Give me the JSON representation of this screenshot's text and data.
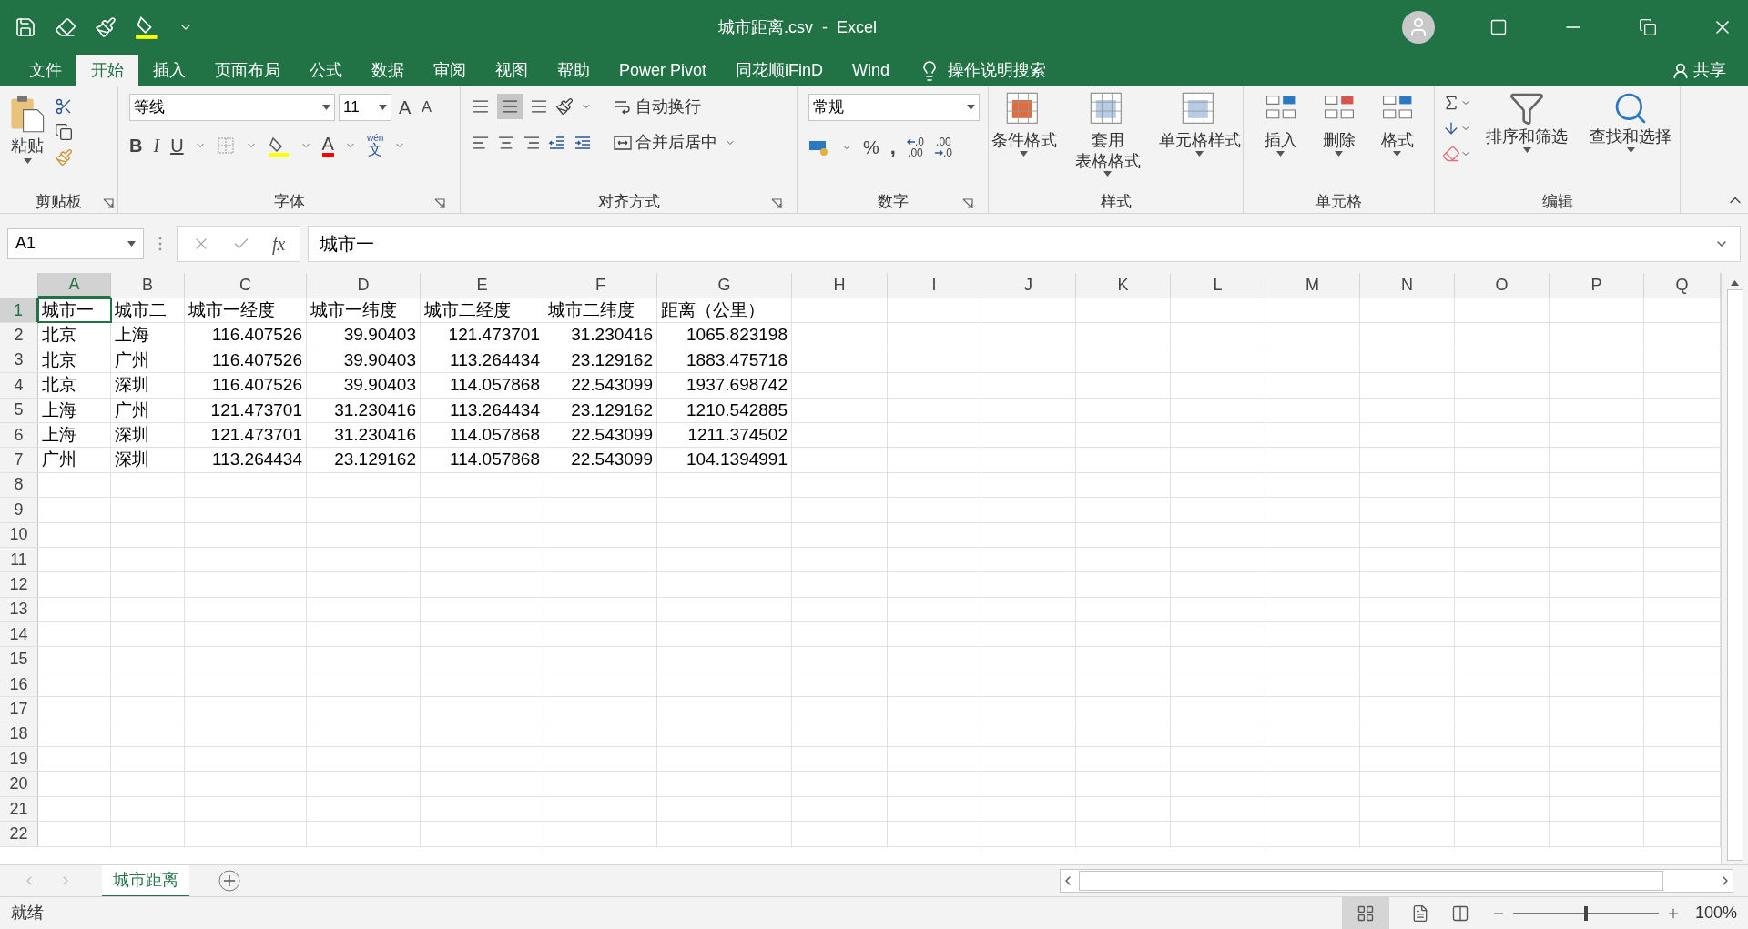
{
  "window": {
    "title": "城市距离.csv  -  Excel"
  },
  "ribbon_tabs": [
    {
      "label": "文件",
      "selected": false
    },
    {
      "label": "开始",
      "selected": true
    },
    {
      "label": "插入",
      "selected": false
    },
    {
      "label": "页面布局",
      "selected": false
    },
    {
      "label": "公式",
      "selected": false
    },
    {
      "label": "数据",
      "selected": false
    },
    {
      "label": "审阅",
      "selected": false
    },
    {
      "label": "视图",
      "selected": false
    },
    {
      "label": "帮助",
      "selected": false
    },
    {
      "label": "Power Pivot",
      "selected": false
    },
    {
      "label": "同花顺iFinD",
      "selected": false
    },
    {
      "label": "Wind",
      "selected": false
    }
  ],
  "tell_me": "操作说明搜索",
  "share": "共享",
  "ribbon": {
    "clipboard": {
      "label": "剪贴板",
      "paste": "粘贴"
    },
    "font": {
      "label": "字体",
      "font_name": "等线",
      "font_size": "11",
      "grow": "A",
      "shrink": "A",
      "bold": "B",
      "italic": "I",
      "underline": "U",
      "font_color": "A",
      "phonetic_top": "wén",
      "phonetic": "文"
    },
    "alignment": {
      "label": "对齐方式",
      "wrap": "自动换行",
      "merge": "合并后居中"
    },
    "number": {
      "label": "数字",
      "format": "常规",
      "percent": "%",
      "comma": ",",
      "increase_decimal": [
        ".0",
        ".00"
      ],
      "decrease_decimal": [
        ".00",
        ".0"
      ]
    },
    "styles": {
      "label": "样式",
      "buttons": [
        [
          "条件格式"
        ],
        [
          "套用",
          "表格格式"
        ],
        [
          "单元格样式"
        ]
      ]
    },
    "cells": {
      "label": "单元格",
      "buttons": [
        [
          "插入"
        ],
        [
          "删除"
        ],
        [
          "格式"
        ]
      ]
    },
    "editing": {
      "label": "编辑",
      "buttons": [
        [
          "排序和筛选"
        ],
        [
          "查找和选择"
        ]
      ]
    }
  },
  "formula_bar": {
    "name_box": "A1",
    "fx": "fx",
    "formula": "城市一"
  },
  "columns": [
    {
      "label": "A",
      "selected": true
    },
    {
      "label": "B",
      "selected": false
    },
    {
      "label": "C",
      "selected": false
    },
    {
      "label": "D",
      "selected": false
    },
    {
      "label": "E",
      "selected": false
    },
    {
      "label": "F",
      "selected": false
    },
    {
      "label": "G",
      "selected": false
    },
    {
      "label": "H",
      "selected": false
    },
    {
      "label": "I",
      "selected": false
    },
    {
      "label": "J",
      "selected": false
    },
    {
      "label": "K",
      "selected": false
    },
    {
      "label": "L",
      "selected": false
    },
    {
      "label": "M",
      "selected": false
    },
    {
      "label": "N",
      "selected": false
    },
    {
      "label": "O",
      "selected": false
    },
    {
      "label": "P",
      "selected": false
    },
    {
      "label": "Q",
      "selected": false
    }
  ],
  "rows": [
    {
      "label": "1",
      "selected": true,
      "cells": [
        {
          "text": "城市一",
          "kind": "text"
        },
        {
          "text": "城市二",
          "kind": "text"
        },
        {
          "text": "城市一经度",
          "kind": "text"
        },
        {
          "text": "城市一纬度",
          "kind": "text"
        },
        {
          "text": "城市二经度",
          "kind": "text"
        },
        {
          "text": "城市二纬度",
          "kind": "text"
        },
        {
          "text": "距离（公里）",
          "kind": "text"
        }
      ]
    },
    {
      "label": "2",
      "selected": false,
      "cells": [
        {
          "text": "北京",
          "kind": "text"
        },
        {
          "text": "上海",
          "kind": "text"
        },
        {
          "text": "116.407526",
          "kind": "number"
        },
        {
          "text": "39.90403",
          "kind": "number"
        },
        {
          "text": "121.473701",
          "kind": "number"
        },
        {
          "text": "31.230416",
          "kind": "number"
        },
        {
          "text": "1065.823198",
          "kind": "number"
        }
      ]
    },
    {
      "label": "3",
      "selected": false,
      "cells": [
        {
          "text": "北京",
          "kind": "text"
        },
        {
          "text": "广州",
          "kind": "text"
        },
        {
          "text": "116.407526",
          "kind": "number"
        },
        {
          "text": "39.90403",
          "kind": "number"
        },
        {
          "text": "113.264434",
          "kind": "number"
        },
        {
          "text": "23.129162",
          "kind": "number"
        },
        {
          "text": "1883.475718",
          "kind": "number"
        }
      ]
    },
    {
      "label": "4",
      "selected": false,
      "cells": [
        {
          "text": "北京",
          "kind": "text"
        },
        {
          "text": "深圳",
          "kind": "text"
        },
        {
          "text": "116.407526",
          "kind": "number"
        },
        {
          "text": "39.90403",
          "kind": "number"
        },
        {
          "text": "114.057868",
          "kind": "number"
        },
        {
          "text": "22.543099",
          "kind": "number"
        },
        {
          "text": "1937.698742",
          "kind": "number"
        }
      ]
    },
    {
      "label": "5",
      "selected": false,
      "cells": [
        {
          "text": "上海",
          "kind": "text"
        },
        {
          "text": "广州",
          "kind": "text"
        },
        {
          "text": "121.473701",
          "kind": "number"
        },
        {
          "text": "31.230416",
          "kind": "number"
        },
        {
          "text": "113.264434",
          "kind": "number"
        },
        {
          "text": "23.129162",
          "kind": "number"
        },
        {
          "text": "1210.542885",
          "kind": "number"
        }
      ]
    },
    {
      "label": "6",
      "selected": false,
      "cells": [
        {
          "text": "上海",
          "kind": "text"
        },
        {
          "text": "深圳",
          "kind": "text"
        },
        {
          "text": "121.473701",
          "kind": "number"
        },
        {
          "text": "31.230416",
          "kind": "number"
        },
        {
          "text": "114.057868",
          "kind": "number"
        },
        {
          "text": "22.543099",
          "kind": "number"
        },
        {
          "text": "1211.374502",
          "kind": "number"
        }
      ]
    },
    {
      "label": "7",
      "selected": false,
      "cells": [
        {
          "text": "广州",
          "kind": "text"
        },
        {
          "text": "深圳",
          "kind": "text"
        },
        {
          "text": "113.264434",
          "kind": "number"
        },
        {
          "text": "23.129162",
          "kind": "number"
        },
        {
          "text": "114.057868",
          "kind": "number"
        },
        {
          "text": "22.543099",
          "kind": "number"
        },
        {
          "text": "104.1394991",
          "kind": "number"
        }
      ]
    },
    {
      "label": "8",
      "selected": false,
      "cells": []
    },
    {
      "label": "9",
      "selected": false,
      "cells": []
    },
    {
      "label": "10",
      "selected": false,
      "cells": []
    },
    {
      "label": "11",
      "selected": false,
      "cells": []
    },
    {
      "label": "12",
      "selected": false,
      "cells": []
    },
    {
      "label": "13",
      "selected": false,
      "cells": []
    },
    {
      "label": "14",
      "selected": false,
      "cells": []
    },
    {
      "label": "15",
      "selected": false,
      "cells": []
    },
    {
      "label": "16",
      "selected": false,
      "cells": []
    },
    {
      "label": "17",
      "selected": false,
      "cells": []
    },
    {
      "label": "18",
      "selected": false,
      "cells": []
    },
    {
      "label": "19",
      "selected": false,
      "cells": []
    },
    {
      "label": "20",
      "selected": false,
      "cells": []
    },
    {
      "label": "21",
      "selected": false,
      "cells": []
    },
    {
      "label": "22",
      "selected": false,
      "cells": []
    }
  ],
  "sheet_tabs": [
    {
      "label": "城市距离",
      "selected": true
    }
  ],
  "status_bar": {
    "status": "就绪",
    "zoom": "100%",
    "zoom_level": {
      "level": 0.5
    }
  }
}
